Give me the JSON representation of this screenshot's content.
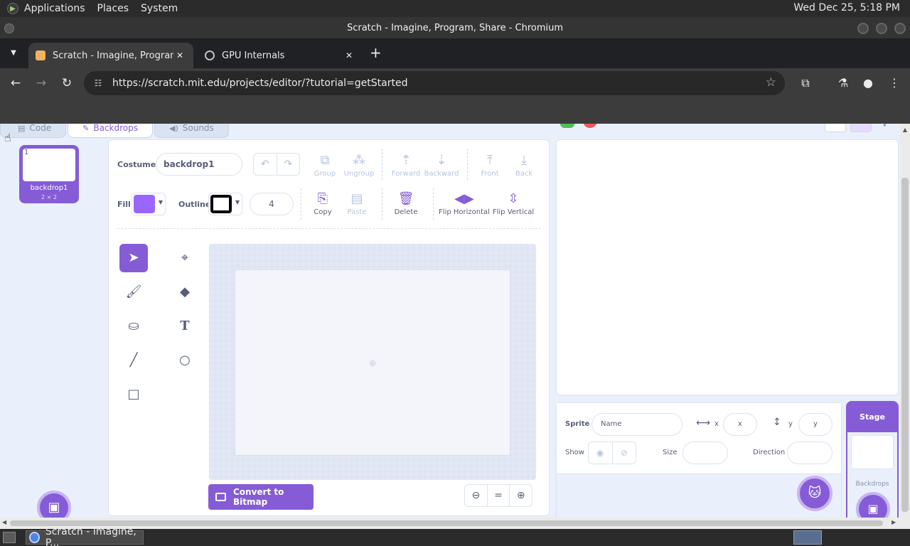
{
  "os": {
    "menus": [
      "Applications",
      "Places",
      "System"
    ],
    "clock": "Wed Dec 25,  5:18 PM"
  },
  "window": {
    "title": "Scratch - Imagine, Program, Share - Chromium"
  },
  "browser": {
    "tabs": [
      {
        "title": "Scratch - Imagine, Program, Share",
        "active": true
      },
      {
        "title": "GPU Internals",
        "active": false
      }
    ],
    "url": "https://scratch.mit.edu/projects/editor/?tutorial=getStarted"
  },
  "editor": {
    "tabs": {
      "code": "Code",
      "backdrops": "Backdrops",
      "sounds": "Sounds"
    },
    "backdrops": [
      {
        "index": "1",
        "name": "backdrop1",
        "size": "2 × 2"
      }
    ],
    "paint": {
      "costume_label": "Costume",
      "costume_name": "backdrop1",
      "tools_row1": {
        "group": "Group",
        "ungroup": "Ungroup",
        "forward": "Forward",
        "backward": "Backward",
        "front": "Front",
        "back": "Back"
      },
      "fill_label": "Fill",
      "outline_label": "Outline",
      "outline_width": "4",
      "tools_row2": {
        "copy": "Copy",
        "paste": "Paste",
        "delete": "Delete",
        "flip_horizontal": "Flip Horizontal",
        "flip_vertical": "Flip Vertical"
      },
      "convert_button": "Convert to Bitmap",
      "colors": {
        "fill": "#9966ff",
        "outline": "#000000",
        "accent": "#855cd6"
      }
    },
    "sprite_info": {
      "sprite_label": "Sprite",
      "name_placeholder": "Name",
      "x_label": "x",
      "x_placeholder": "x",
      "y_label": "y",
      "y_placeholder": "y",
      "show_label": "Show",
      "size_label": "Size",
      "direction_label": "Direction"
    },
    "stage_panel": {
      "title": "Stage",
      "label": "Backdrops"
    }
  },
  "taskbar": {
    "item": "Scratch - Imagine, P..."
  }
}
